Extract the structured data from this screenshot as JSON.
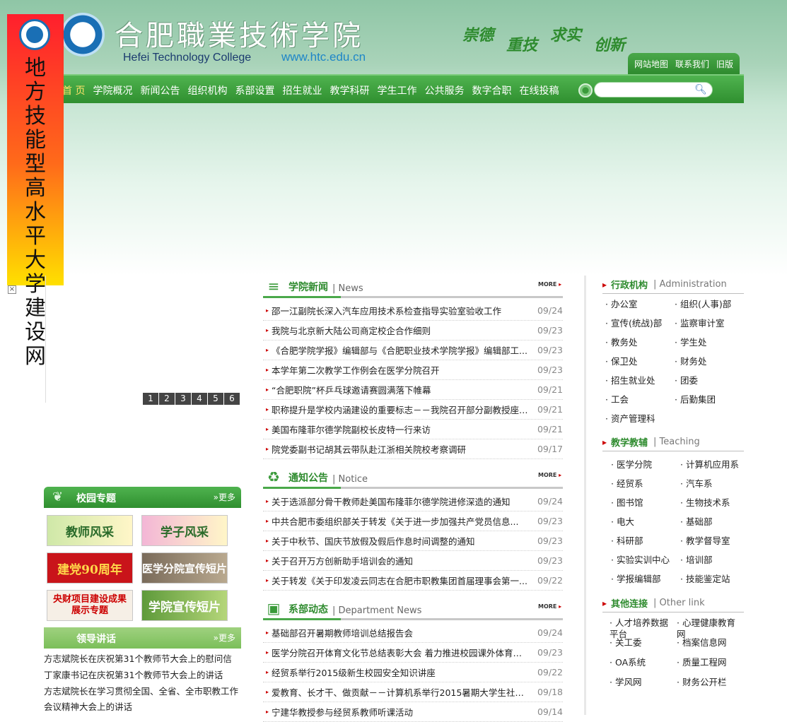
{
  "site": {
    "title_cn": "合肥職業技術学院",
    "title_en": "Hefei Technology College",
    "url": "www.htc.edu.cn",
    "motto": [
      "崇德",
      "重技",
      "求实",
      "创新"
    ]
  },
  "toplinks": [
    "网站地图",
    "联系我们",
    "旧版"
  ],
  "nav": [
    "首 页",
    "学院概况",
    "新闻公告",
    "组织机构",
    "系部设置",
    "招生就业",
    "教学科研",
    "学生工作",
    "公共服务",
    "数字合职",
    "在线投稿"
  ],
  "float_ad": {
    "text": "地方技能型高水平大学建设网",
    "close": "×"
  },
  "slider": {
    "pages": [
      "1",
      "2",
      "3",
      "4",
      "5",
      "6"
    ]
  },
  "news": {
    "title": "学院新闻",
    "en": "| News",
    "more": "MORE",
    "items": [
      {
        "t": "邵一江副院长深入汽车应用技术系检查指导实验室验收工作",
        "d": "09/24"
      },
      {
        "t": "我院与北京新大陆公司商定校企合作细则",
        "d": "09/23"
      },
      {
        "t": "《合肥学院学报》编辑部与《合肥职业技术学院学报》编辑部工...",
        "d": "09/23"
      },
      {
        "t": "本学年第二次教学工作例会在医学分院召开",
        "d": "09/23"
      },
      {
        "t": "“合肥职院”杯乒乓球邀请赛圆满落下帷幕",
        "d": "09/21"
      },
      {
        "t": "职称提升是学校内涵建设的重要标志－－我院召开部分副教授座谈会",
        "d": "09/21"
      },
      {
        "t": "美国布隆菲尔德学院副校长皮特一行来访",
        "d": "09/21"
      },
      {
        "t": "院党委副书记胡其云带队赴江浙相关院校考察调研",
        "d": "09/17"
      }
    ]
  },
  "notice": {
    "title": "通知公告",
    "en": "| Notice",
    "more": "MORE",
    "items": [
      {
        "t": "关于选派部分骨干教师赴美国布隆菲尔德学院进修深造的通知",
        "d": "09/24"
      },
      {
        "t": "中共合肥市委组织部关于转发《关于进一步加强共产党员信息...",
        "d": "09/23"
      },
      {
        "t": "关于中秋节、国庆节放假及假后作息时间调整的通知",
        "d": "09/23"
      },
      {
        "t": "关于召开万方创新助手培训会的通知",
        "d": "09/23"
      },
      {
        "t": "关于转发《关于印发凌云同志在合肥市职教集团首届理事会第一...",
        "d": "09/22"
      }
    ]
  },
  "dept": {
    "title": "系部动态",
    "en": "| Department News",
    "more": "MORE",
    "items": [
      {
        "t": "基础部召开暑期教师培训总结报告会",
        "d": "09/24"
      },
      {
        "t": "医学分院召开体育文化节总结表彰大会 着力推进校园课外体育文...",
        "d": "09/23"
      },
      {
        "t": "经贸系举行2015级新生校园安全知识讲座",
        "d": "09/22"
      },
      {
        "t": "爱教育、长才干、做贡献－－计算机系举行2015暑期大学生社会...",
        "d": "09/18"
      },
      {
        "t": "宁建华教授参与经贸系教师听课活动",
        "d": "09/14"
      }
    ]
  },
  "campus": {
    "title": "校园专题",
    "more": "»更多",
    "tiles": [
      "教师风采",
      "学子风采",
      "建党90周年",
      "医学分院宣传短片",
      "央财项目建设成果展示专题",
      "学院宣传短片"
    ]
  },
  "leaders": {
    "title": "领导讲话",
    "more": "»更多",
    "items": [
      "方志斌院长在庆祝第31个教师节大会上的慰问信",
      "丁家康书记在庆祝第31个教师节大会上的讲话",
      "方志斌院长在学习贯彻全国、全省、全市职教工作会议精神大会上的讲话"
    ]
  },
  "admin": {
    "title": "行政机构",
    "en": "| Administration",
    "items": [
      "办公室",
      "组织(人事)部",
      "宣传(统战)部",
      "监察审计室",
      "教务处",
      "学生处",
      "保卫处",
      "财务处",
      "招生就业处",
      "团委",
      "工会",
      "后勤集团",
      "资产管理科"
    ]
  },
  "teach": {
    "title": "教学教辅",
    "en": "| Teaching",
    "items": [
      "医学分院",
      "计算机应用系",
      "经贸系",
      "汽车系",
      "图书馆",
      "生物技术系",
      "电大",
      "基础部",
      "科研部",
      "教学督导室",
      "实验实训中心",
      "培训部",
      "学报编辑部",
      "技能鉴定站"
    ]
  },
  "links": {
    "title": "其他连接",
    "en": "| Other link",
    "items": [
      "人才培养数据平台",
      "心理健康教育网",
      "关工委",
      "档案信息网",
      "OA系统",
      "质量工程网",
      "学风网",
      "财务公开栏"
    ]
  },
  "colors": {
    "green": "#2e8b2e",
    "accent": "#4fb34f",
    "red": "#cc0000"
  }
}
